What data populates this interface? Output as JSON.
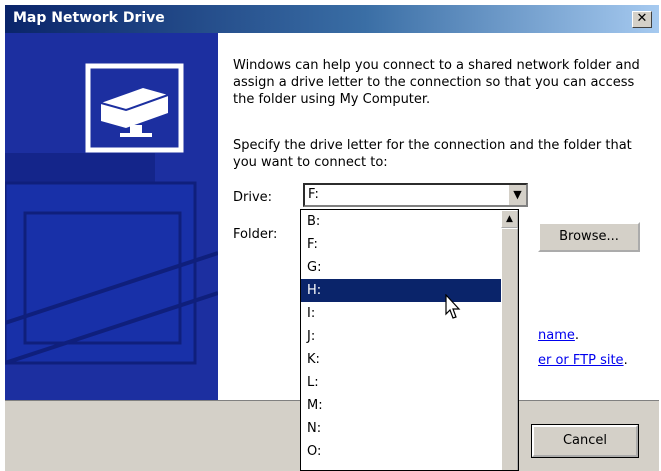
{
  "window": {
    "title": "Map Network Drive"
  },
  "intro_text": "Windows can help you connect to a shared network folder and assign a drive letter to the connection so that you can access the folder using My Computer.",
  "prompt_text": "Specify the drive letter for the connection and the folder that you want to connect to:",
  "form": {
    "drive_label": "Drive:",
    "drive_value": "F:",
    "folder_label": "Folder:",
    "browse_label": "Browse..."
  },
  "dropdown": {
    "items": [
      "B:",
      "F:",
      "G:",
      "H:",
      "I:",
      "J:",
      "K:",
      "L:",
      "M:",
      "N:",
      "O:"
    ],
    "highlighted": "H:"
  },
  "links": {
    "link1_fragment": "name",
    "link2_fragment": "er or FTP site"
  },
  "link_suffix": ".",
  "footer": {
    "cancel_label": "Cancel"
  },
  "icons": [
    "close-icon",
    "network-drive-icon",
    "chevron-down-icon",
    "scroll-up-icon",
    "mouse-cursor-icon"
  ],
  "colors": {
    "title_start": "#0a246a",
    "title_end": "#a6caf0",
    "art_bg": "#1c2fa0",
    "selection": "#0a246a",
    "link": "#0000ee"
  }
}
